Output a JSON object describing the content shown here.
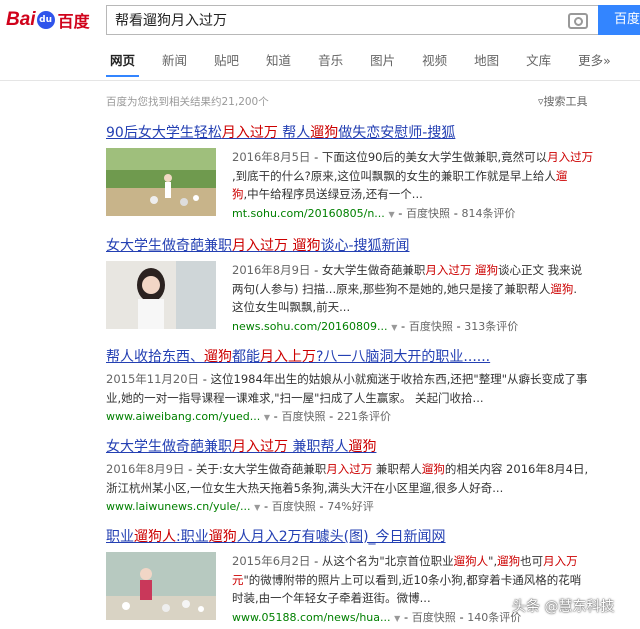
{
  "logo": {
    "bai": "Bai",
    "du": "du",
    "baidu_cn": "百度"
  },
  "search": {
    "query": "帮看遛狗月入过万",
    "button": "百度"
  },
  "tabs": [
    "网页",
    "新闻",
    "贴吧",
    "知道",
    "音乐",
    "图片",
    "视频",
    "地图",
    "文库",
    "更多»"
  ],
  "result_count": "百度为您找到相关结果约21,200个",
  "search_tools": "搜索工具",
  "results": [
    {
      "title": [
        "90后女大学生轻松",
        "月入过万",
        " 帮人",
        "遛狗",
        "做失恋安慰师-搜狐"
      ],
      "date": "2016年8月5日",
      "lines": [
        [
          "- 下面这位90后的美女大学生做兼职,竟然可以",
          "月入过万"
        ],
        [
          ",到底干的什么?原来,这位叫飘飘的女生的兼职工作就是早上给人",
          "遛"
        ],
        [
          "狗",
          ",中午给程序员送绿豆汤,还有一个..."
        ]
      ],
      "url": "mt.sohu.com/20160805/n...",
      "kuaizhao": "百度快照",
      "count": "814条评价"
    },
    {
      "title": [
        "女大学生做奇葩兼职",
        "月入过万",
        " ",
        "遛狗",
        "谈心-搜狐新闻"
      ],
      "date": "2016年8月9日",
      "lines": [
        [
          "- 女大学生做奇葩兼职",
          "月入过万",
          " ",
          "遛狗",
          "谈心正文 我来说"
        ],
        [
          "两句(人参与) 扫描...原来,那些狗不是她的,她只是接了兼职帮人",
          "遛狗",
          "."
        ],
        [
          "这位女生叫飘飘,前天..."
        ]
      ],
      "url": "news.sohu.com/20160809...",
      "kuaizhao": "百度快照",
      "count": "313条评价"
    },
    {
      "title": [
        "帮人收拾东西、",
        "遛狗",
        "都能",
        "月入上万",
        "?八一八脑洞大开的职业......"
      ],
      "date": "2015年11月20日",
      "lines": [
        [
          "- 这位1984年出生的姑娘从小就痴迷于收拾东西,还把\"整理\"从癖长变成了事"
        ],
        [
          "业,她的一对一指导课程一课难求,\"扫一屋\"扫成了人生赢家。 关起门收拾..."
        ]
      ],
      "url": "www.aiweibang.com/yued...",
      "kuaizhao": "百度快照",
      "count": "221条评价"
    },
    {
      "title": [
        "女大学生做奇葩兼职",
        "月入过万",
        " 兼职帮人",
        "遛狗"
      ],
      "date": "2016年8月9日",
      "lines": [
        [
          "- 关于:女大学生做奇葩兼职",
          "月入过万",
          " 兼职帮人",
          "遛狗",
          "的相关内容 2016年8月4日,"
        ],
        [
          "浙江杭州某小区,一位女生大热天拖着5条狗,满头大汗在小区里遛,很多人好奇..."
        ]
      ],
      "url": "www.laiwunews.cn/yule/...",
      "kuaizhao": "百度快照",
      "count": "74%好评"
    },
    {
      "title": [
        "职业",
        "遛狗人",
        ":职业",
        "遛狗",
        "人月入2万有噱头(图)_今日新闻网"
      ],
      "date": "2015年6月2日",
      "lines": [
        [
          "- 从这个名为\"北京首位职业",
          "遛狗人",
          "\",",
          "遛狗",
          "也可",
          "月入万"
        ],
        [
          "元",
          "\"的微博附带的照片上可以看到,近10条小狗,都穿着卡通风格的花哨"
        ],
        [
          "时装,由一个年轻女子牵着逛街。微博..."
        ]
      ],
      "url": "www.05188.com/news/hua...",
      "kuaizhao": "百度快照",
      "count": "140条评价"
    }
  ],
  "watermark": "头条 @慧东科技",
  "colors": {
    "title": "#2440b3",
    "highlight": "#cc0000",
    "url": "#008000",
    "search_button": "#3385ff",
    "logo": "#d0021b"
  }
}
